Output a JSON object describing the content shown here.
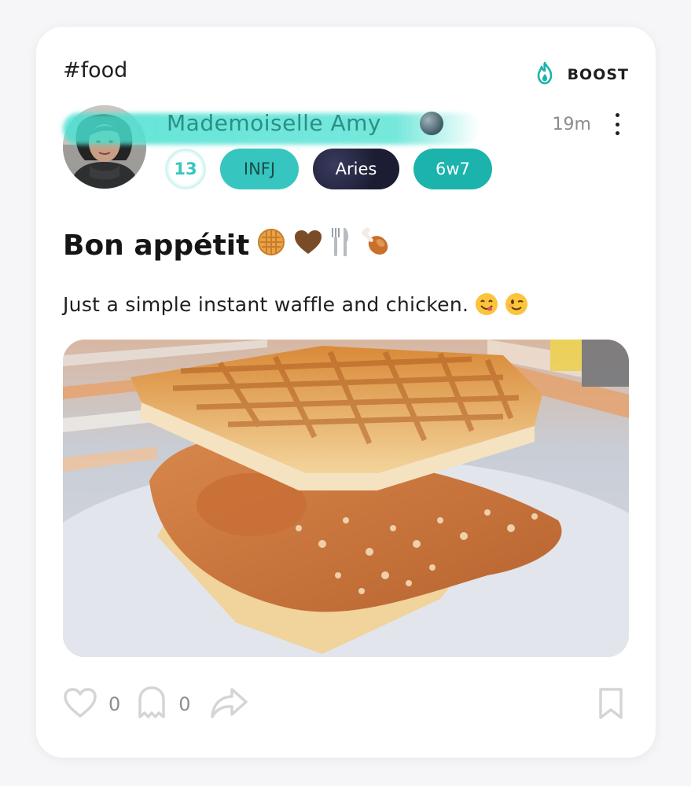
{
  "post": {
    "hashtag": "#food",
    "boost_label": "BOOST",
    "author": {
      "name": "Mademoiselle Amy",
      "time": "19m",
      "badges": {
        "level": "13",
        "mbti": "INFJ",
        "zodiac": "Aries",
        "enneagram": "6w7"
      }
    },
    "title": "Bon appétit",
    "title_emojis": [
      "waffle",
      "brown-heart",
      "fork-and-knife",
      "poultry-leg"
    ],
    "body": "Just a simple instant waffle and chicken.",
    "body_emojis": [
      "yum-face",
      "winking-face"
    ],
    "image_subject": "waffle and fried chicken sandwich",
    "stats": {
      "likes": "0",
      "comments": "0"
    }
  },
  "colors": {
    "accent": "#36c6bf",
    "name_text": "#2b8f86",
    "boost_icon": "#1bb3ac"
  },
  "icons": [
    "boost-flame-icon",
    "more-vertical-icon",
    "heart-icon",
    "ghost-comment-icon",
    "share-icon",
    "bookmark-icon"
  ]
}
